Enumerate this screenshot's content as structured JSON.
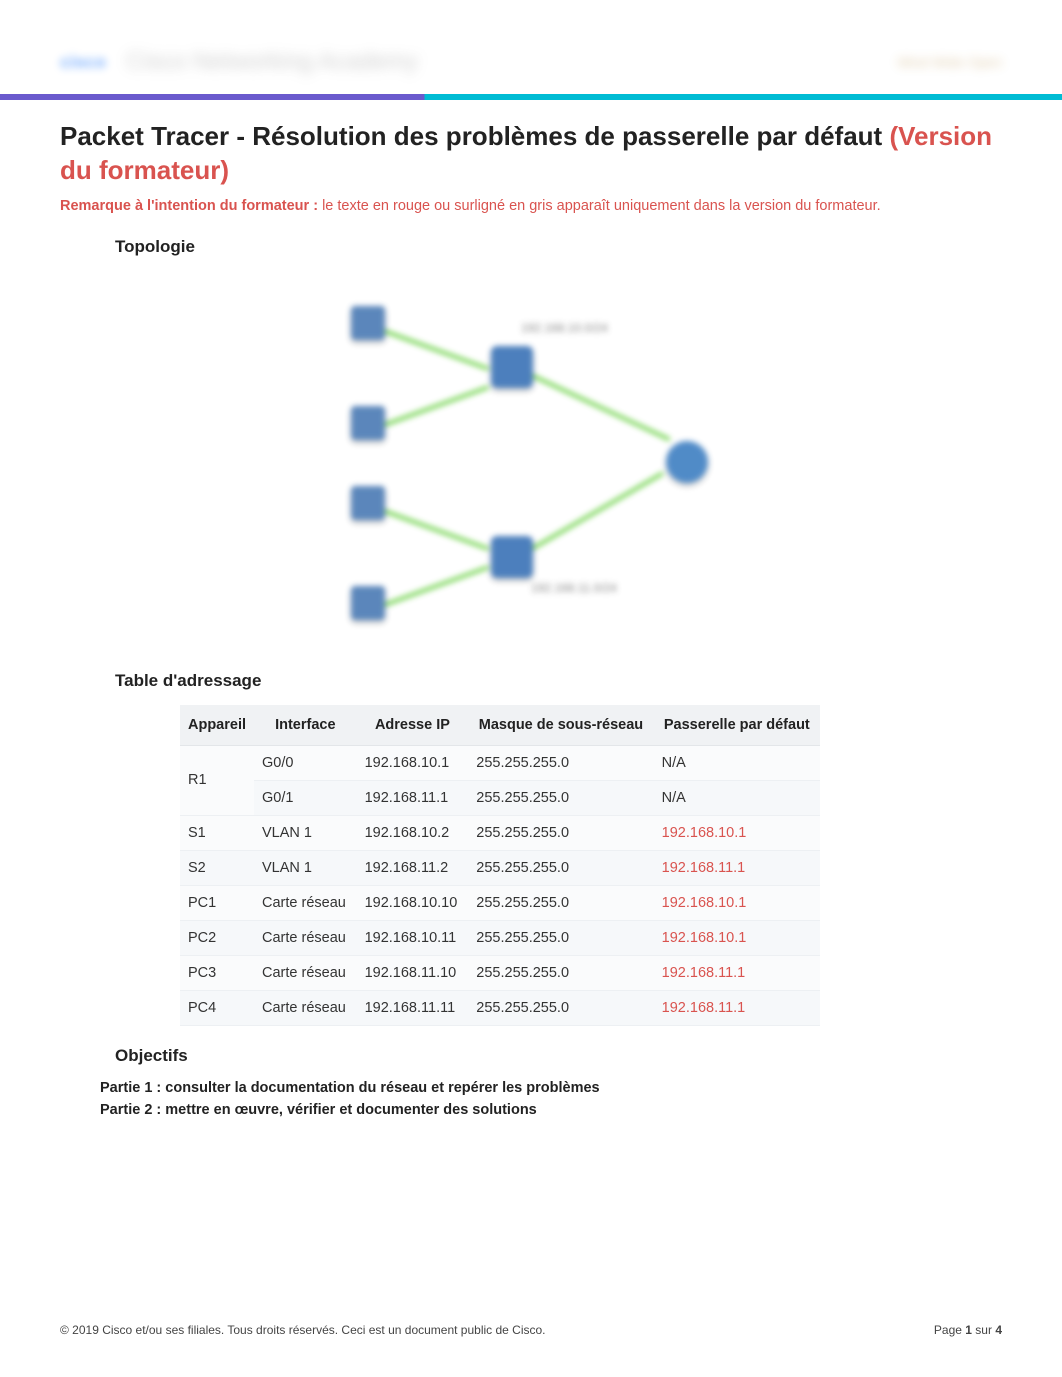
{
  "header": {
    "logo_text": "cisco",
    "center_text": "Cisco Networking Academy",
    "right_text": "Mind Wide Open"
  },
  "title_main": "Packet Tracer - Résolution des problèmes de passerelle par défaut ",
  "title_red": "(Version du formateur)",
  "remark_bold": "Remarque à l'intention du formateur : ",
  "remark_rest": "le texte en rouge ou surligné en gris apparaît uniquement dans la version du formateur.",
  "section_topologie": "Topologie",
  "topology_label_top": "192.168.10.0/24",
  "topology_label_bottom": "192.168.11.0/24",
  "section_table": "Table d'adressage",
  "table_headers": {
    "device": "Appareil",
    "iface": "Interface",
    "ip": "Adresse IP",
    "mask": "Masque de sous-réseau",
    "gw": "Passerelle par défaut"
  },
  "rows": [
    {
      "device": "R1",
      "iface": "G0/0",
      "ip": "192.168.10.1",
      "mask": "255.255.255.0",
      "gw": "N/A",
      "gw_red": false,
      "rowspan": 2
    },
    {
      "device": "",
      "iface": "G0/1",
      "ip": "192.168.11.1",
      "mask": "255.255.255.0",
      "gw": "N/A",
      "gw_red": false,
      "rowspan": 0
    },
    {
      "device": "S1",
      "iface": "VLAN 1",
      "ip": "192.168.10.2",
      "mask": "255.255.255.0",
      "gw": "192.168.10.1",
      "gw_red": true,
      "rowspan": 1
    },
    {
      "device": "S2",
      "iface": "VLAN 1",
      "ip": "192.168.11.2",
      "mask": "255.255.255.0",
      "gw": "192.168.11.1",
      "gw_red": true,
      "rowspan": 1
    },
    {
      "device": "PC1",
      "iface": "Carte réseau",
      "ip": "192.168.10.10",
      "mask": "255.255.255.0",
      "gw": "192.168.10.1",
      "gw_red": true,
      "rowspan": 1
    },
    {
      "device": "PC2",
      "iface": "Carte réseau",
      "ip": "192.168.10.11",
      "mask": "255.255.255.0",
      "gw": "192.168.10.1",
      "gw_red": true,
      "rowspan": 1
    },
    {
      "device": "PC3",
      "iface": "Carte réseau",
      "ip": "192.168.11.10",
      "mask": "255.255.255.0",
      "gw": "192.168.11.1",
      "gw_red": true,
      "rowspan": 1
    },
    {
      "device": "PC4",
      "iface": "Carte réseau",
      "ip": "192.168.11.11",
      "mask": "255.255.255.0",
      "gw": "192.168.11.1",
      "gw_red": true,
      "rowspan": 1
    }
  ],
  "section_objectifs": "Objectifs",
  "objectifs": [
    "Partie 1 : consulter la documentation du réseau et repérer les problèmes",
    "Partie 2 : mettre en œuvre, vérifier et documenter des solutions"
  ],
  "footer_left": "© 2019 Cisco et/ou ses filiales. Tous droits réservés. Ceci est un document public de Cisco.",
  "footer_page_prefix": "Page ",
  "footer_page_current": "1",
  "footer_page_mid": " sur ",
  "footer_page_total": "4"
}
